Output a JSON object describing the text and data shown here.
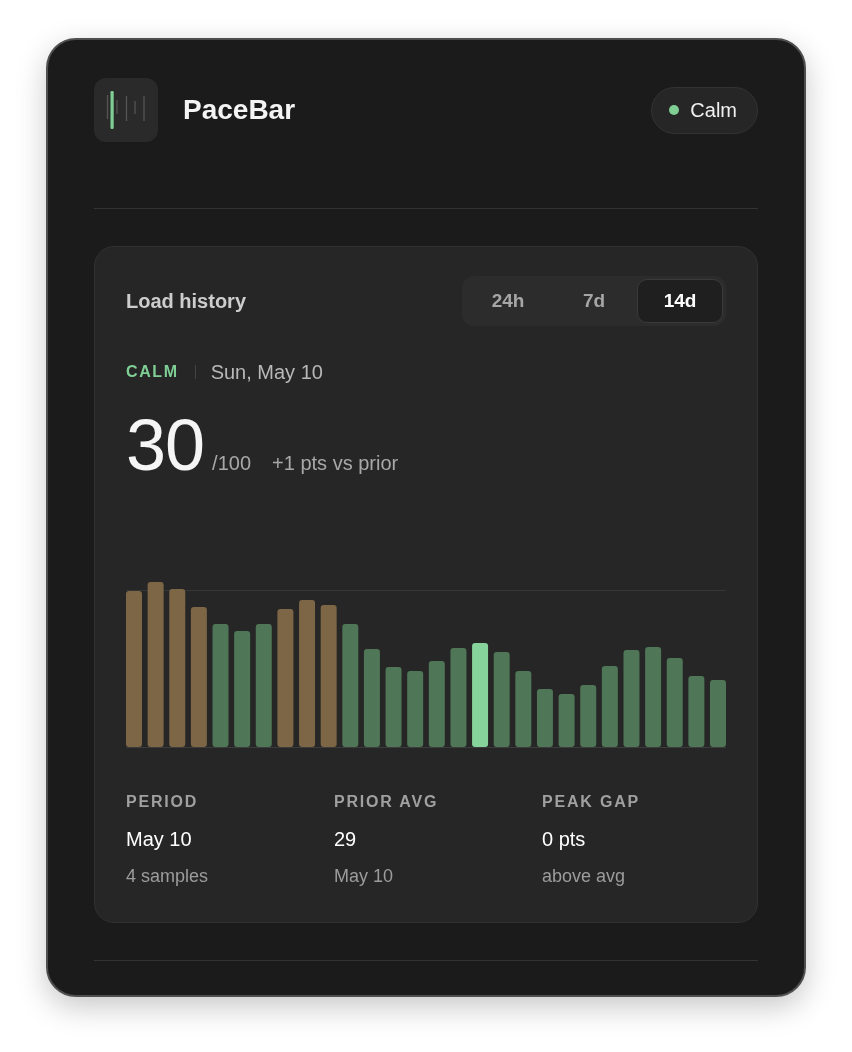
{
  "header": {
    "title": "PaceBar",
    "status": {
      "label": "Calm",
      "kind": "calm"
    }
  },
  "history": {
    "title": "Load history",
    "tabs": [
      {
        "label": "24h",
        "selected": false
      },
      {
        "label": "7d",
        "selected": false
      },
      {
        "label": "14d",
        "selected": true
      }
    ],
    "reading": {
      "state": "CALM",
      "kind": "calm",
      "date": "Sun, May 10",
      "score": "30",
      "scale": "/100",
      "delta": "+1 pts vs prior"
    },
    "bars": [
      {
        "kind": "elevated",
        "selected": false
      },
      {
        "kind": "elevated",
        "selected": false
      },
      {
        "kind": "elevated",
        "selected": false
      },
      {
        "kind": "elevated",
        "selected": false
      },
      {
        "kind": "calm",
        "selected": false
      },
      {
        "kind": "calm",
        "selected": false
      },
      {
        "kind": "calm",
        "selected": false
      },
      {
        "kind": "elevated",
        "selected": false
      },
      {
        "kind": "elevated",
        "selected": false
      },
      {
        "kind": "elevated",
        "selected": false
      },
      {
        "kind": "calm",
        "selected": false
      },
      {
        "kind": "calm",
        "selected": false
      },
      {
        "kind": "calm",
        "selected": false
      },
      {
        "kind": "calm",
        "selected": false
      },
      {
        "kind": "calm",
        "selected": false
      },
      {
        "kind": "calm",
        "selected": false
      },
      {
        "kind": "calm",
        "selected": true
      },
      {
        "kind": "calm",
        "selected": false
      },
      {
        "kind": "calm",
        "selected": false
      },
      {
        "kind": "calm",
        "selected": false
      },
      {
        "kind": "calm",
        "selected": false
      },
      {
        "kind": "calm",
        "selected": false
      },
      {
        "kind": "calm",
        "selected": false
      },
      {
        "kind": "calm",
        "selected": false
      },
      {
        "kind": "calm",
        "selected": false
      },
      {
        "kind": "calm",
        "selected": false
      },
      {
        "kind": "calm",
        "selected": false
      },
      {
        "kind": "calm",
        "selected": false
      }
    ],
    "stats": [
      {
        "label": "PERIOD",
        "value": "May 10",
        "note": "4 samples"
      },
      {
        "label": "PRIOR AVG",
        "value": "29",
        "note": "May 10"
      },
      {
        "label": "PEAK GAP",
        "value": "0 pts",
        "note": "above avg"
      }
    ]
  }
}
